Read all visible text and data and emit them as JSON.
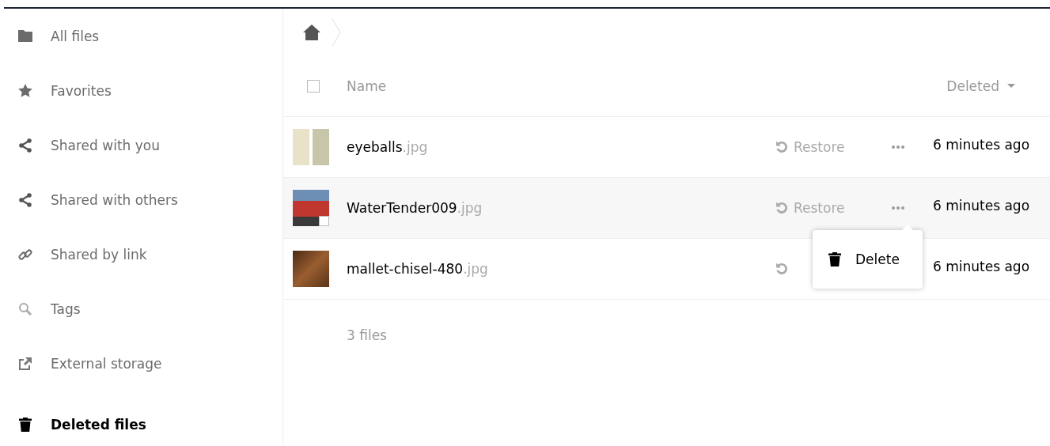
{
  "sidebar": {
    "items": [
      {
        "label": "All files",
        "selected": false
      },
      {
        "label": "Favorites",
        "selected": false
      },
      {
        "label": "Shared with you",
        "selected": false
      },
      {
        "label": "Shared with others",
        "selected": false
      },
      {
        "label": "Shared by link",
        "selected": false
      },
      {
        "label": "Tags",
        "selected": false
      },
      {
        "label": "External storage",
        "selected": false
      },
      {
        "label": "Deleted files",
        "selected": true
      }
    ]
  },
  "table": {
    "columns": {
      "name": "Name",
      "deleted": "Deleted"
    },
    "all_selected": false,
    "rows": [
      {
        "name": "eyeballs",
        "extension": ".jpg",
        "restore": "Restore",
        "deleted": "6 minutes ago",
        "selected": false,
        "menu_open": false
      },
      {
        "name": "WaterTender009",
        "extension": ".jpg",
        "restore": "Restore",
        "deleted": "6 minutes ago",
        "selected": true,
        "menu_open": true
      },
      {
        "name": "mallet-chisel-480",
        "extension": ".jpg",
        "deleted": "6 minutes ago",
        "selected": false,
        "menu_open": false
      }
    ],
    "summary": "3 files"
  },
  "menu": {
    "items": [
      "Delete"
    ]
  }
}
